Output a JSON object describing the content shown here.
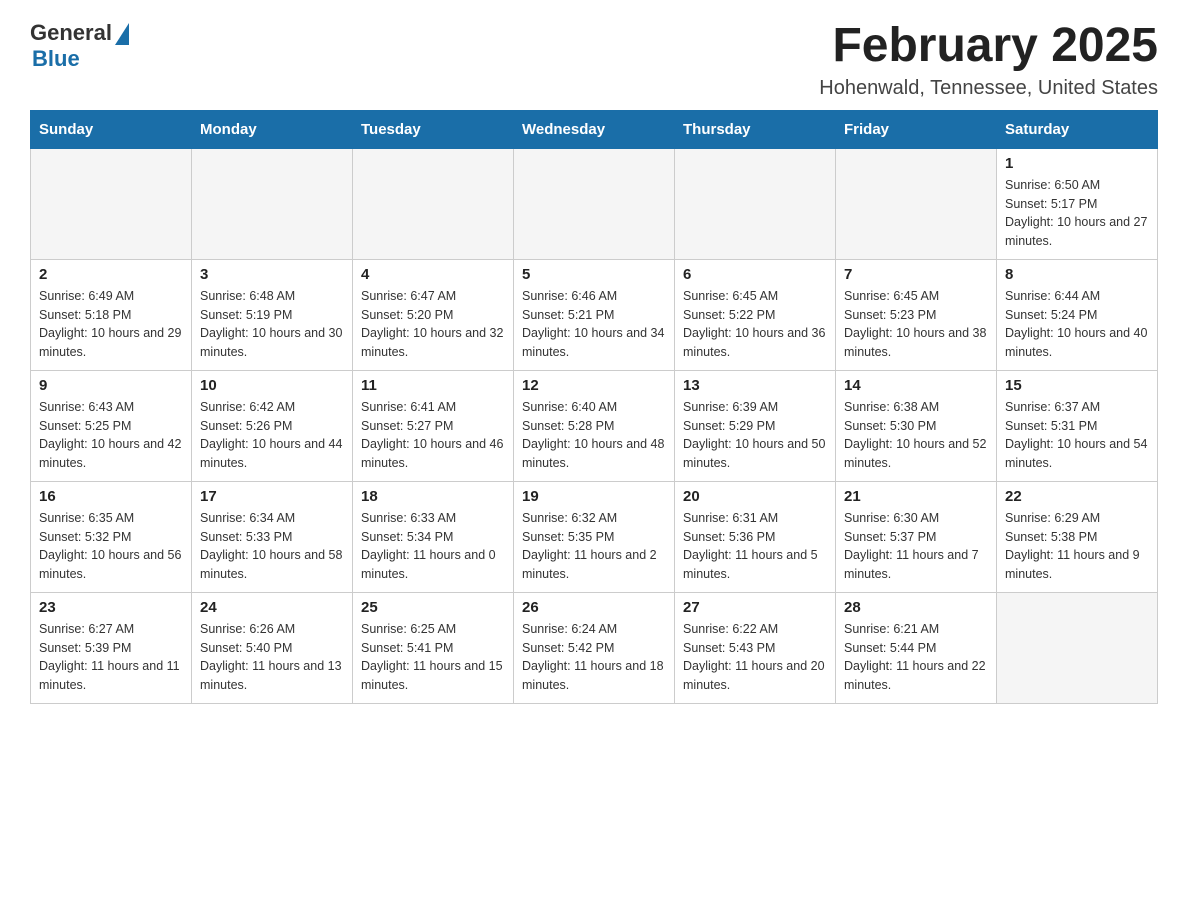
{
  "logo": {
    "general": "General",
    "blue": "Blue"
  },
  "title": "February 2025",
  "location": "Hohenwald, Tennessee, United States",
  "days_of_week": [
    "Sunday",
    "Monday",
    "Tuesday",
    "Wednesday",
    "Thursday",
    "Friday",
    "Saturday"
  ],
  "weeks": [
    [
      {
        "day": "",
        "info": ""
      },
      {
        "day": "",
        "info": ""
      },
      {
        "day": "",
        "info": ""
      },
      {
        "day": "",
        "info": ""
      },
      {
        "day": "",
        "info": ""
      },
      {
        "day": "",
        "info": ""
      },
      {
        "day": "1",
        "info": "Sunrise: 6:50 AM\nSunset: 5:17 PM\nDaylight: 10 hours and 27 minutes."
      }
    ],
    [
      {
        "day": "2",
        "info": "Sunrise: 6:49 AM\nSunset: 5:18 PM\nDaylight: 10 hours and 29 minutes."
      },
      {
        "day": "3",
        "info": "Sunrise: 6:48 AM\nSunset: 5:19 PM\nDaylight: 10 hours and 30 minutes."
      },
      {
        "day": "4",
        "info": "Sunrise: 6:47 AM\nSunset: 5:20 PM\nDaylight: 10 hours and 32 minutes."
      },
      {
        "day": "5",
        "info": "Sunrise: 6:46 AM\nSunset: 5:21 PM\nDaylight: 10 hours and 34 minutes."
      },
      {
        "day": "6",
        "info": "Sunrise: 6:45 AM\nSunset: 5:22 PM\nDaylight: 10 hours and 36 minutes."
      },
      {
        "day": "7",
        "info": "Sunrise: 6:45 AM\nSunset: 5:23 PM\nDaylight: 10 hours and 38 minutes."
      },
      {
        "day": "8",
        "info": "Sunrise: 6:44 AM\nSunset: 5:24 PM\nDaylight: 10 hours and 40 minutes."
      }
    ],
    [
      {
        "day": "9",
        "info": "Sunrise: 6:43 AM\nSunset: 5:25 PM\nDaylight: 10 hours and 42 minutes."
      },
      {
        "day": "10",
        "info": "Sunrise: 6:42 AM\nSunset: 5:26 PM\nDaylight: 10 hours and 44 minutes."
      },
      {
        "day": "11",
        "info": "Sunrise: 6:41 AM\nSunset: 5:27 PM\nDaylight: 10 hours and 46 minutes."
      },
      {
        "day": "12",
        "info": "Sunrise: 6:40 AM\nSunset: 5:28 PM\nDaylight: 10 hours and 48 minutes."
      },
      {
        "day": "13",
        "info": "Sunrise: 6:39 AM\nSunset: 5:29 PM\nDaylight: 10 hours and 50 minutes."
      },
      {
        "day": "14",
        "info": "Sunrise: 6:38 AM\nSunset: 5:30 PM\nDaylight: 10 hours and 52 minutes."
      },
      {
        "day": "15",
        "info": "Sunrise: 6:37 AM\nSunset: 5:31 PM\nDaylight: 10 hours and 54 minutes."
      }
    ],
    [
      {
        "day": "16",
        "info": "Sunrise: 6:35 AM\nSunset: 5:32 PM\nDaylight: 10 hours and 56 minutes."
      },
      {
        "day": "17",
        "info": "Sunrise: 6:34 AM\nSunset: 5:33 PM\nDaylight: 10 hours and 58 minutes."
      },
      {
        "day": "18",
        "info": "Sunrise: 6:33 AM\nSunset: 5:34 PM\nDaylight: 11 hours and 0 minutes."
      },
      {
        "day": "19",
        "info": "Sunrise: 6:32 AM\nSunset: 5:35 PM\nDaylight: 11 hours and 2 minutes."
      },
      {
        "day": "20",
        "info": "Sunrise: 6:31 AM\nSunset: 5:36 PM\nDaylight: 11 hours and 5 minutes."
      },
      {
        "day": "21",
        "info": "Sunrise: 6:30 AM\nSunset: 5:37 PM\nDaylight: 11 hours and 7 minutes."
      },
      {
        "day": "22",
        "info": "Sunrise: 6:29 AM\nSunset: 5:38 PM\nDaylight: 11 hours and 9 minutes."
      }
    ],
    [
      {
        "day": "23",
        "info": "Sunrise: 6:27 AM\nSunset: 5:39 PM\nDaylight: 11 hours and 11 minutes."
      },
      {
        "day": "24",
        "info": "Sunrise: 6:26 AM\nSunset: 5:40 PM\nDaylight: 11 hours and 13 minutes."
      },
      {
        "day": "25",
        "info": "Sunrise: 6:25 AM\nSunset: 5:41 PM\nDaylight: 11 hours and 15 minutes."
      },
      {
        "day": "26",
        "info": "Sunrise: 6:24 AM\nSunset: 5:42 PM\nDaylight: 11 hours and 18 minutes."
      },
      {
        "day": "27",
        "info": "Sunrise: 6:22 AM\nSunset: 5:43 PM\nDaylight: 11 hours and 20 minutes."
      },
      {
        "day": "28",
        "info": "Sunrise: 6:21 AM\nSunset: 5:44 PM\nDaylight: 11 hours and 22 minutes."
      },
      {
        "day": "",
        "info": ""
      }
    ]
  ]
}
